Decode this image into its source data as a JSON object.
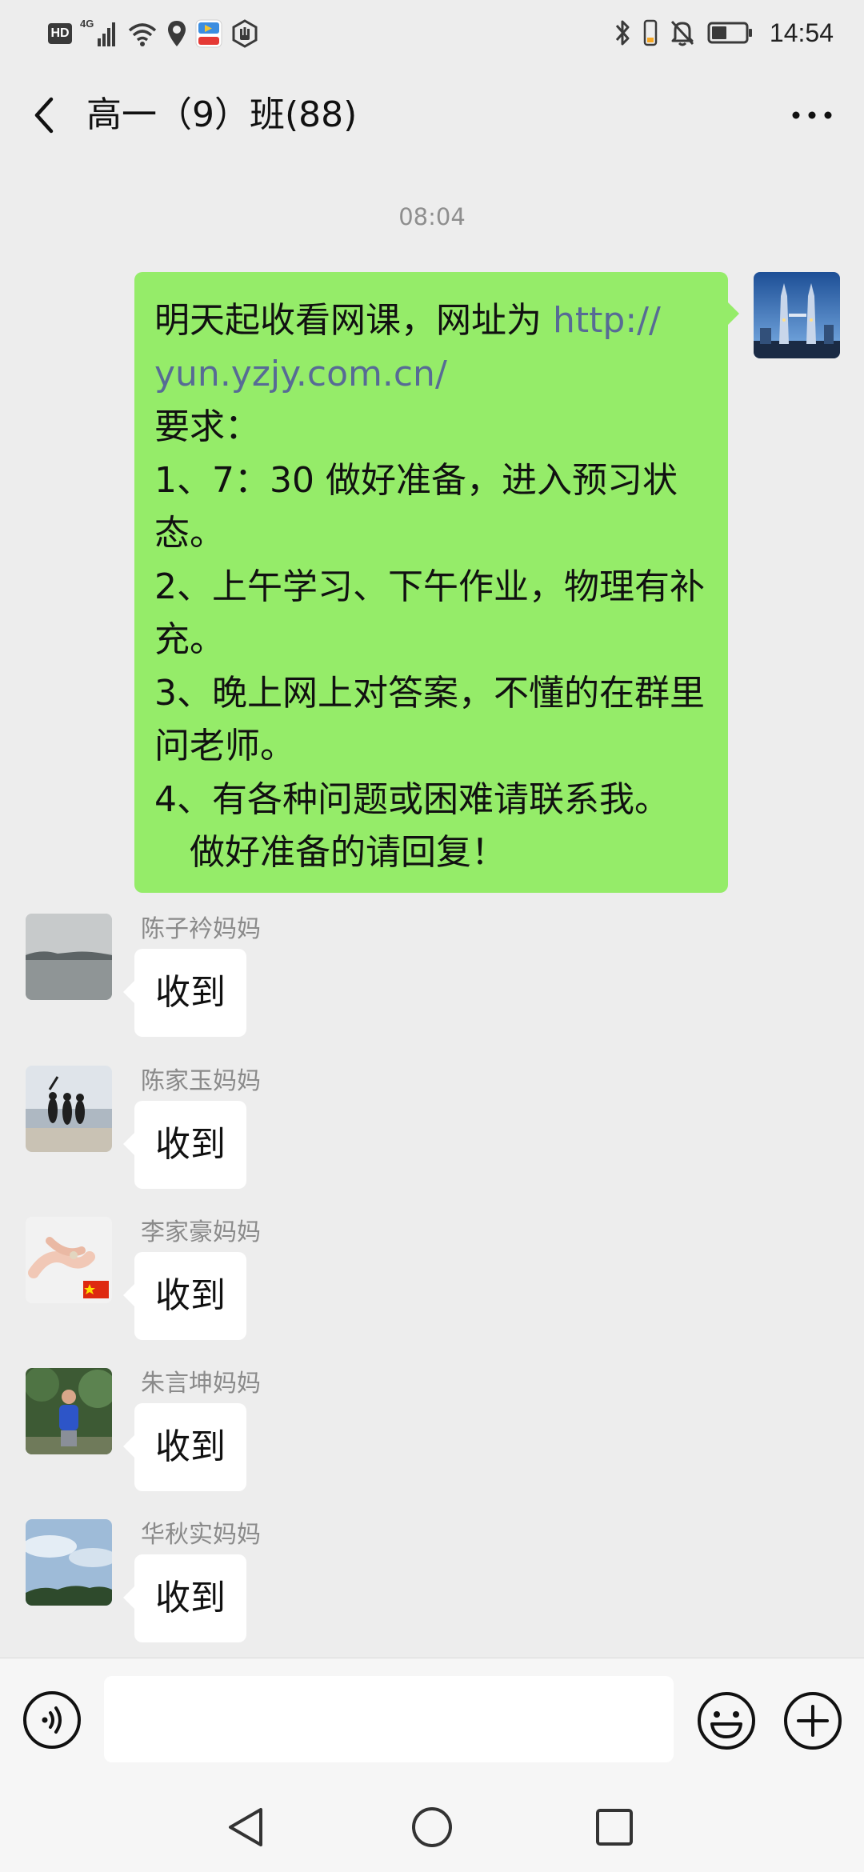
{
  "status_bar": {
    "hd_label": "HD",
    "network_label": "4G",
    "time": "14:54",
    "icons": [
      "hd-icon",
      "signal-icon",
      "wifi-icon",
      "location-icon",
      "app-icon",
      "hand-icon",
      "bluetooth-icon",
      "phone-battery-icon",
      "mute-icon",
      "battery-icon"
    ]
  },
  "header": {
    "back_icon": "chevron-left-icon",
    "title": "高一（9）班(88)",
    "more_icon": "more-dots-icon"
  },
  "chat": {
    "timestamp": "08:04",
    "outgoing": {
      "lines": [
        {
          "text": "明天起收看网课，网址为 ",
          "link": "http://"
        },
        {
          "text": "",
          "link": "yun.yzjy.com.cn/"
        },
        {
          "text": "要求："
        },
        {
          "text": "1、7：30 做好准备，进入预习状"
        },
        {
          "text": "态。"
        },
        {
          "text": "2、上午学习、下午作业，物理有补"
        },
        {
          "text": "充。"
        },
        {
          "text": "3、晚上网上对答案，不懂的在群里"
        },
        {
          "text": "问老师。"
        },
        {
          "text": "4、有各种问题或困难请联系我。"
        },
        {
          "text": "做好准备的请回复！"
        }
      ]
    },
    "incoming": [
      {
        "sender": "陈子衿妈妈",
        "text": "收到"
      },
      {
        "sender": "陈家玉妈妈",
        "text": "收到"
      },
      {
        "sender": "李家豪妈妈",
        "text": "收到"
      },
      {
        "sender": "朱言坤妈妈",
        "text": "收到"
      },
      {
        "sender": "华秋实妈妈",
        "text": "收到"
      }
    ]
  },
  "input_bar": {
    "value": "",
    "voice_icon": "voice-icon",
    "emoji_icon": "emoji-icon",
    "plus_icon": "plus-icon"
  },
  "colors": {
    "background": "#ededed",
    "outgoing_bubble": "#95ec69",
    "incoming_bubble": "#ffffff",
    "link": "#576b95",
    "muted_text": "#8e8e8e"
  }
}
